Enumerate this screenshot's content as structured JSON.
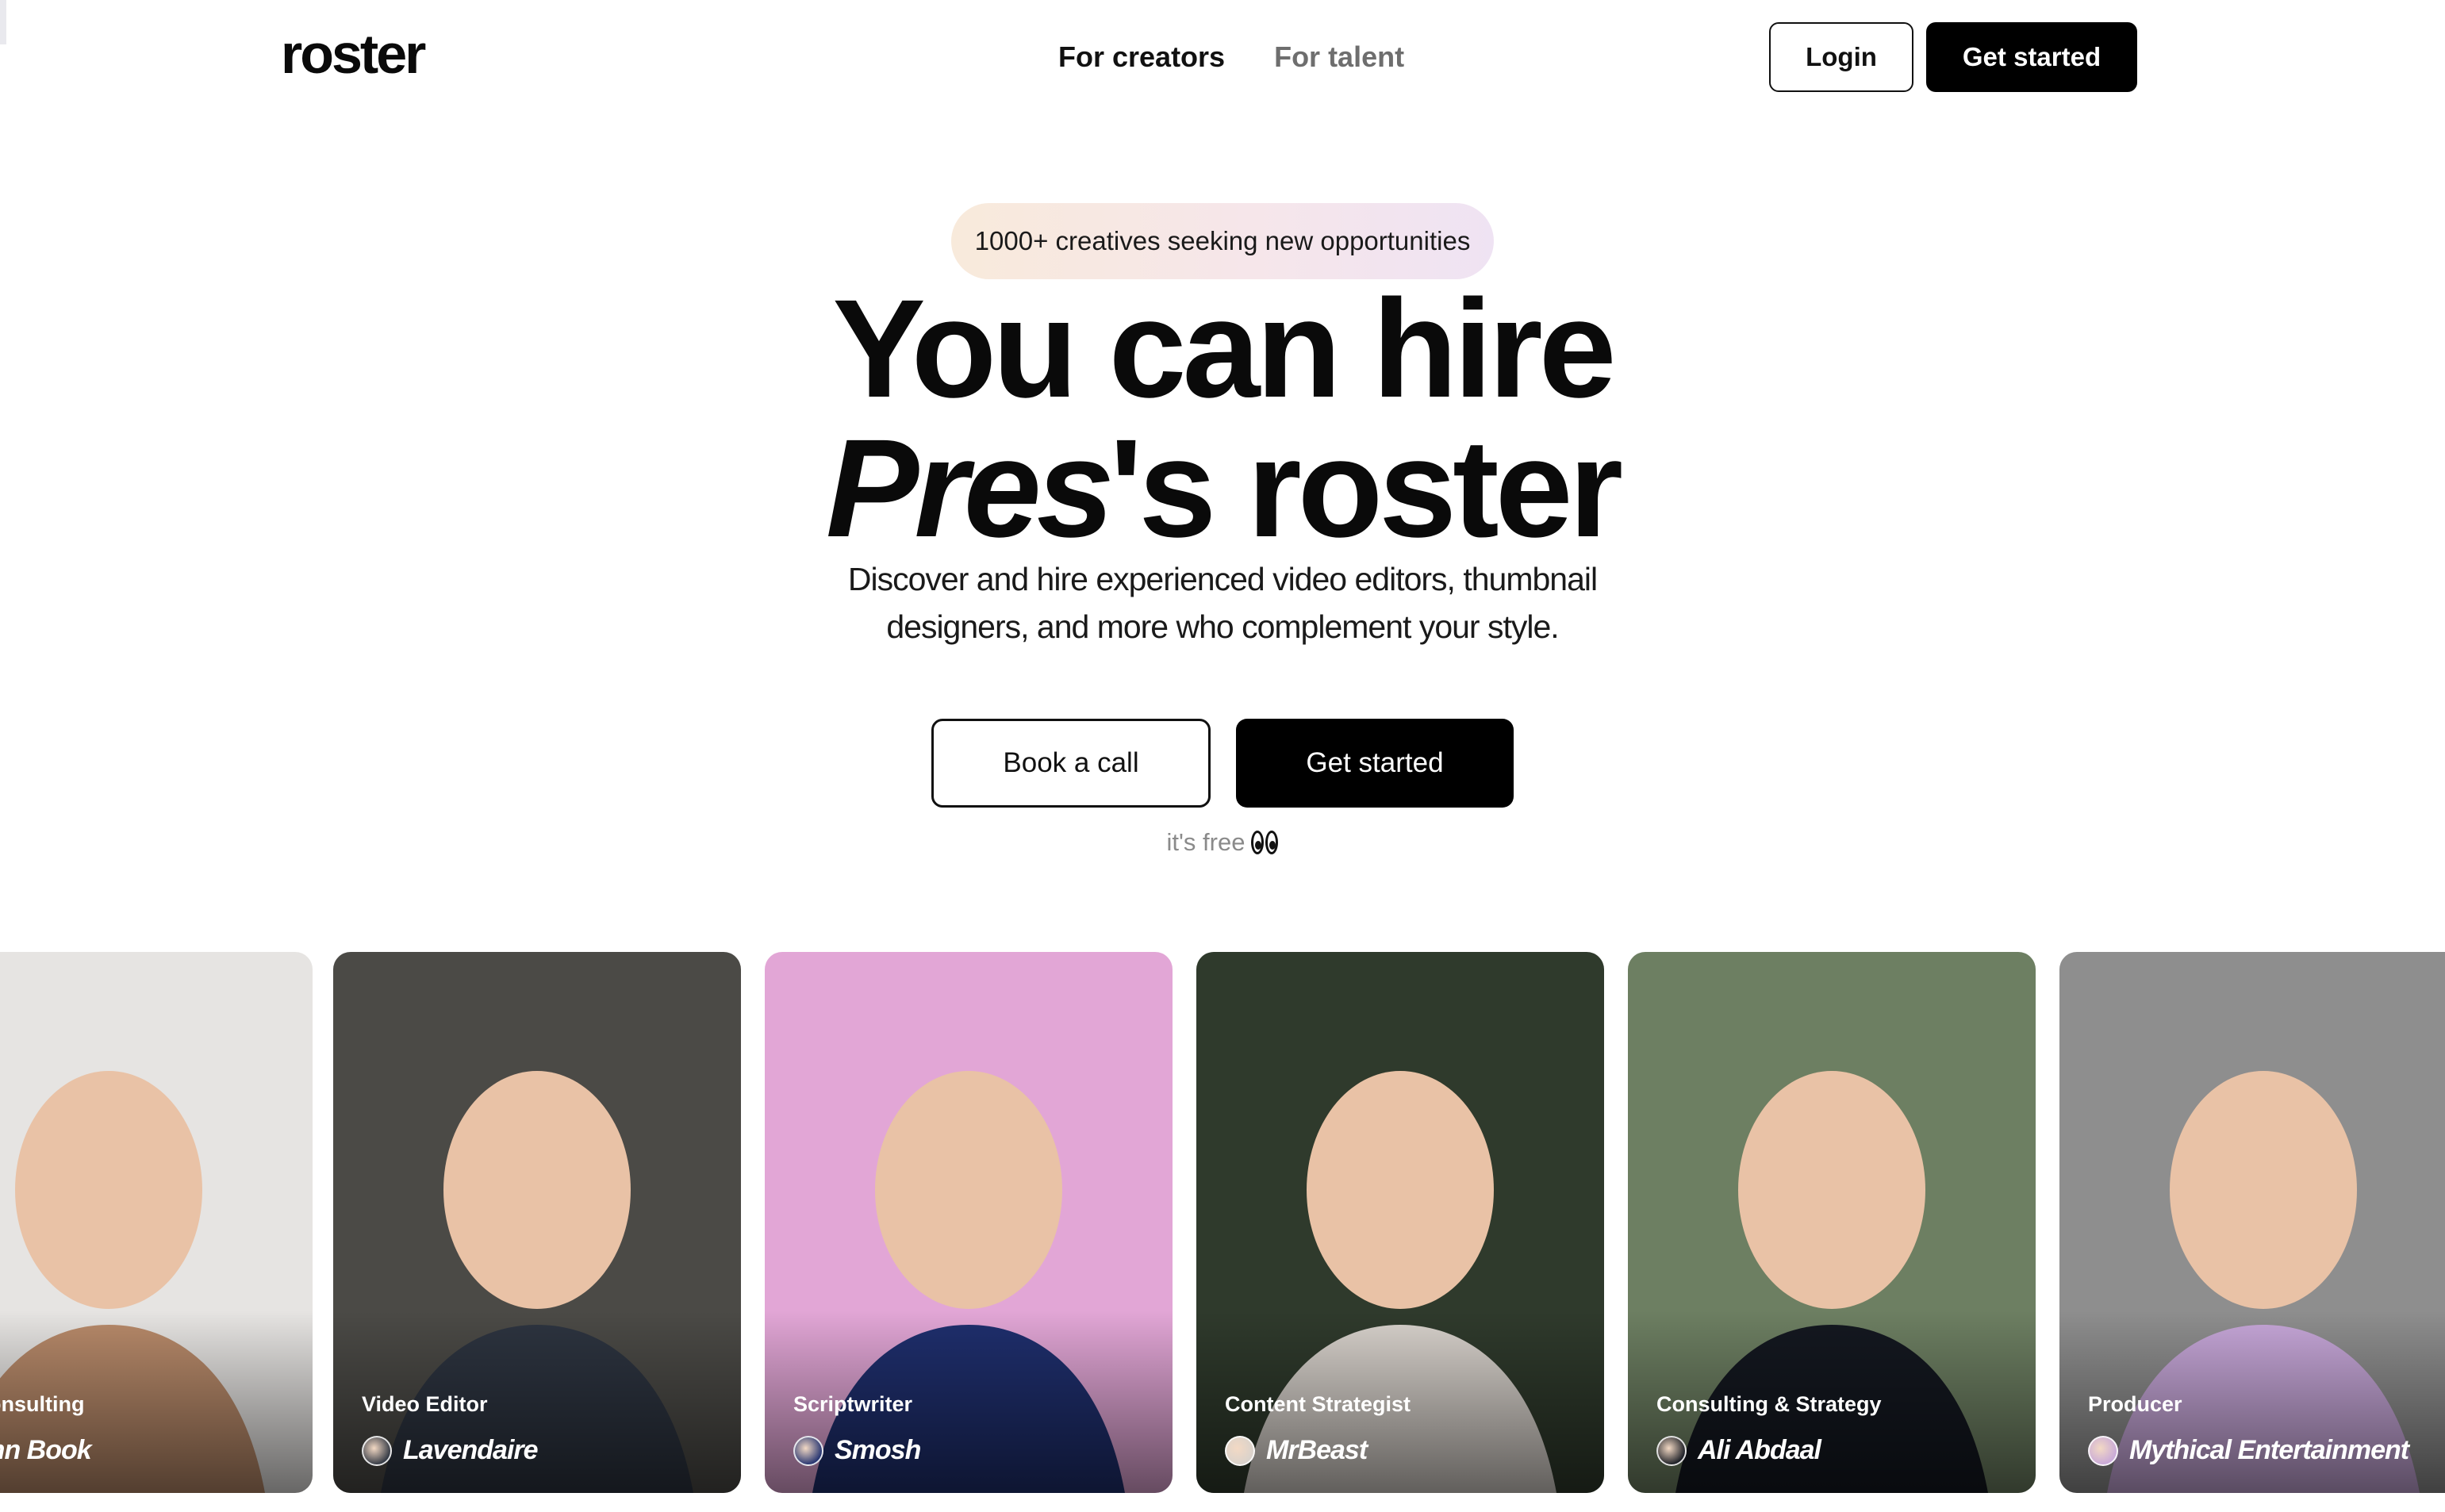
{
  "header": {
    "logo": "roster",
    "nav": [
      {
        "label": "For creators",
        "active": true
      },
      {
        "label": "For talent",
        "active": false
      }
    ],
    "login_label": "Login",
    "get_started_label": "Get started"
  },
  "hero": {
    "pill": "1000+ creatives seeking new opportunities",
    "headline_line1": "You can hire",
    "headline_name": "Pres",
    "headline_suffix": "'s roster",
    "subcopy": "Discover and hire experienced video editors, thumbnail designers, and more who complement your style.",
    "book_call_label": "Book a call",
    "get_started_label": "Get started",
    "free_note": "it's free",
    "free_note_icon": "eyes-emoji"
  },
  "cards": [
    {
      "role": "y & Consulting",
      "creator": "organn Book",
      "avatar_icon": "none",
      "colors": {
        "bg": "#e6e4e2",
        "accent": "#b88a6a"
      }
    },
    {
      "role": "Video Editor",
      "creator": "Lavendaire",
      "avatar_icon": "lavendaire-avatar",
      "colors": {
        "bg": "#4b4a46",
        "accent": "#2d3440"
      }
    },
    {
      "role": "Scriptwriter",
      "creator": "Smosh",
      "avatar_icon": "smosh-avatar",
      "colors": {
        "bg": "#e2a6d6",
        "accent": "#1f2f6e"
      }
    },
    {
      "role": "Content Strategist",
      "creator": "MrBeast",
      "avatar_icon": "mrbeast-avatar",
      "colors": {
        "bg": "#2f3a2c",
        "accent": "#d8d2cc"
      }
    },
    {
      "role": "Consulting & Strategy",
      "creator": "Ali Abdaal",
      "avatar_icon": "ali-abdaal-avatar",
      "colors": {
        "bg": "#6d7f62",
        "accent": "#141820"
      }
    },
    {
      "role": "Producer",
      "creator": "Mythical Entertainment",
      "avatar_icon": "mythical-avatar",
      "colors": {
        "bg": "#8e8e8e",
        "accent": "#c7a7d9"
      }
    }
  ]
}
